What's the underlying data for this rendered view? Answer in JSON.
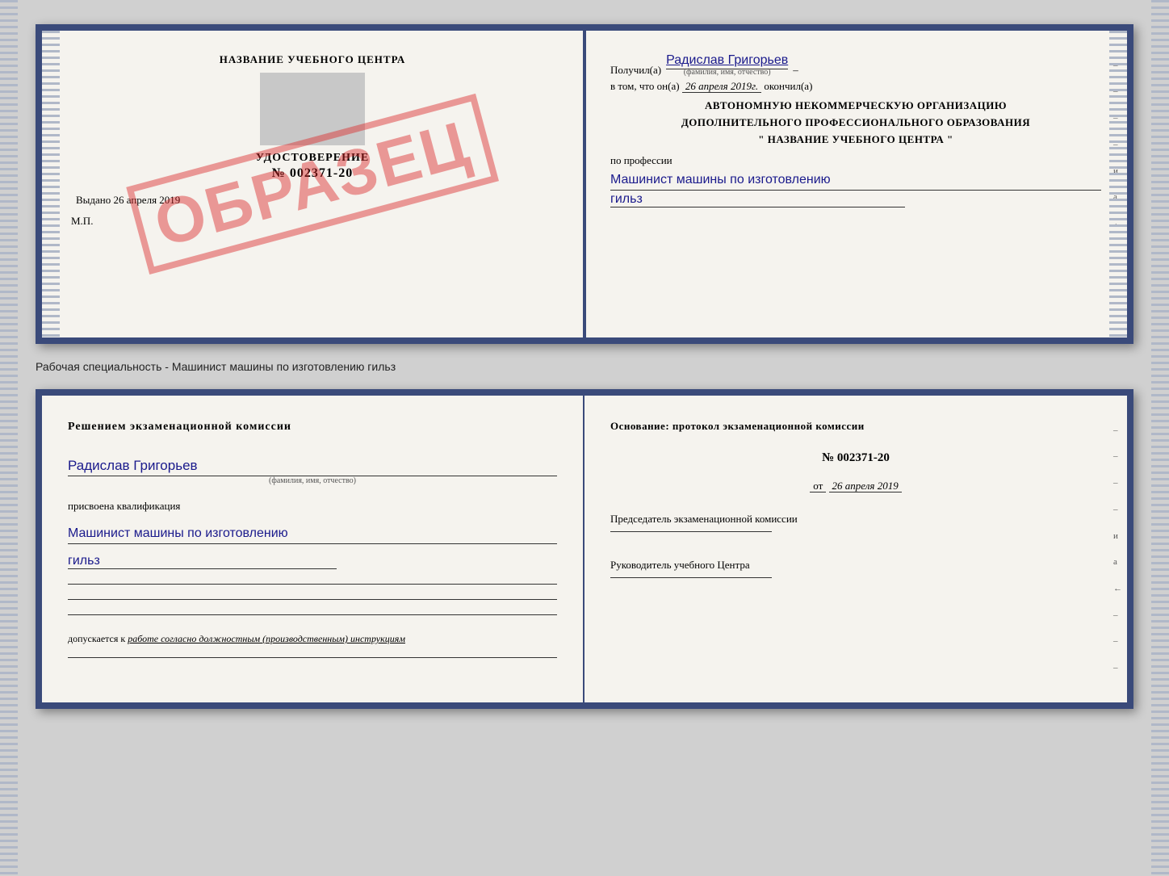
{
  "topDoc": {
    "left": {
      "centerTitle": "НАЗВАНИЕ УЧЕБНОГО ЦЕНТРА",
      "certLabel": "УДОСТОВЕРЕНИЕ",
      "certNumber": "№ 002371-20",
      "issuedLabel": "Выдано",
      "issuedDate": "26 апреля 2019",
      "mpLabel": "М.П.",
      "stampText": "ОБРАЗЕЦ"
    },
    "right": {
      "receivedLabel": "Получил(а)",
      "recipientName": "Радислав Григорьев",
      "fioSubtitle": "(фамилия, имя, отчество)",
      "inThatLabel": "в том, что он(а)",
      "inThatDate": "26 апреля 2019г.",
      "finishedLabel": "окончил(а)",
      "orgLine1": "АВТОНОМНУЮ НЕКОММЕРЧЕСКУЮ ОРГАНИЗАЦИЮ",
      "orgLine2": "ДОПОЛНИТЕЛЬНОГО ПРОФЕССИОНАЛЬНОГО ОБРАЗОВАНИЯ",
      "orgLine3": "\" НАЗВАНИЕ УЧЕБНОГО ЦЕНТРА \"",
      "professionLabel": "по профессии",
      "professionLine1": "Машинист машины по изготовлению",
      "professionLine2": "гильз"
    }
  },
  "separatorLabel": "Рабочая специальность - Машинист машины по изготовлению гильз",
  "bottomDoc": {
    "left": {
      "decisionTitle": "Решением  экзаменационной  комиссии",
      "personName": "Радислав Григорьев",
      "fioSubtitle": "(фамилия, имя, отчество)",
      "assignedLabel": "присвоена квалификация",
      "qualLine1": "Машинист машины по изготовлению",
      "qualLine2": "гильз",
      "allowLabel": "допускается к",
      "allowText": "работе согласно должностным (производственным) инструкциям"
    },
    "right": {
      "basisLabel": "Основание:  протокол  экзаменационной  комиссии",
      "protocolNumber": "№  002371-20",
      "protocolDateLabel": "от",
      "protocolDate": "26 апреля 2019",
      "chairmanLabel": "Председатель экзаменационной комиссии",
      "directorLabel": "Руководитель учебного Центра"
    }
  },
  "sideDashes": [
    "-",
    "-",
    "-",
    "-",
    "и",
    "а",
    "←",
    "-",
    "-",
    "-"
  ],
  "sideDashesBottom": [
    "-",
    "-",
    "-",
    "-",
    "и",
    "а",
    "←",
    "-",
    "-",
    "-"
  ]
}
